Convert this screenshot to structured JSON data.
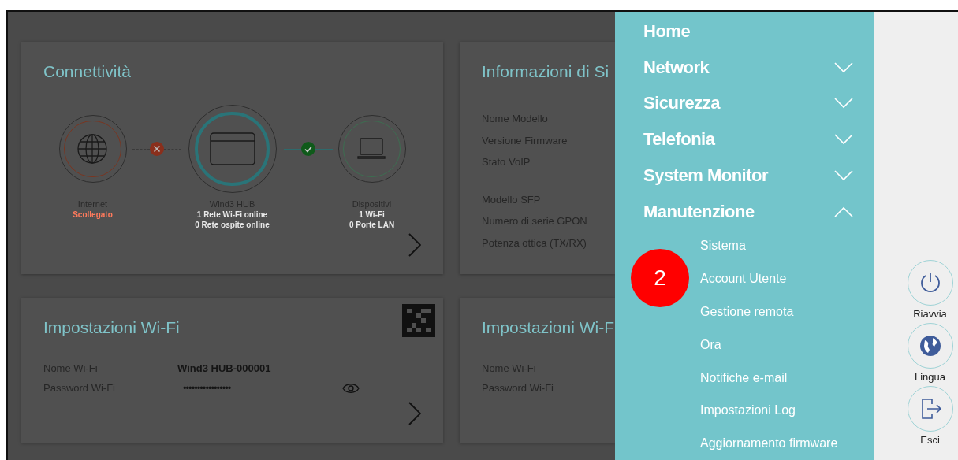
{
  "connectivity": {
    "title": "Connettività",
    "nodes": [
      {
        "kind": "internet",
        "label": "Internet",
        "lines": [
          {
            "text": "Scollegato",
            "kind": "error"
          }
        ]
      },
      {
        "kind": "hub",
        "label": "Wind3 HUB",
        "lines": [
          {
            "text": "1 Rete Wi-Fi online",
            "kind": "info"
          },
          {
            "text": "0 Rete ospite online",
            "kind": "info"
          }
        ]
      },
      {
        "kind": "devices",
        "label": "Dispositivi",
        "lines": [
          {
            "text": "1 Wi-Fi",
            "kind": "info"
          },
          {
            "text": "0 Porte LAN",
            "kind": "info"
          }
        ]
      }
    ],
    "links": [
      {
        "kind": "error"
      },
      {
        "kind": "ok"
      }
    ]
  },
  "system_info": {
    "title": "Informazioni di Si",
    "labels": [
      "Nome Modello",
      "Versione Firmware",
      "Stato VoIP",
      "Modello SFP",
      "Numero di serie GPON",
      "Potenza ottica (TX/RX)"
    ]
  },
  "wifi_settings": {
    "title": "Impostazioni Wi-Fi",
    "rows": [
      {
        "label": "Nome Wi-Fi",
        "value": "Wind3 HUB-000001",
        "kind": "text"
      },
      {
        "label": "Password Wi-Fi",
        "value": "•••••••••••••••••",
        "kind": "password"
      }
    ]
  },
  "wifi_settings_2": {
    "title": "Impostazioni Wi-F",
    "labels": [
      "Nome Wi-Fi",
      "Password Wi-Fi"
    ]
  },
  "menu": {
    "items": [
      {
        "label": "Home",
        "kind": "link"
      },
      {
        "label": "Network",
        "kind": "group",
        "expanded": false
      },
      {
        "label": "Sicurezza",
        "kind": "group",
        "expanded": false
      },
      {
        "label": "Telefonia",
        "kind": "group",
        "expanded": false
      },
      {
        "label": "System Monitor",
        "kind": "group",
        "expanded": false
      },
      {
        "label": "Manutenzione",
        "kind": "group",
        "expanded": true,
        "children": [
          {
            "label": "Sistema"
          },
          {
            "label": "Account Utente"
          },
          {
            "label": "Gestione remota"
          },
          {
            "label": "Ora"
          },
          {
            "label": "Notifiche e-mail"
          },
          {
            "label": "Impostazioni Log"
          },
          {
            "label": "Aggiornamento firmware"
          }
        ]
      }
    ]
  },
  "step_badge": "2",
  "actions": [
    {
      "kind": "power",
      "label": "Riavvia"
    },
    {
      "kind": "language",
      "label": "Lingua"
    },
    {
      "kind": "logout",
      "label": "Esci"
    }
  ]
}
